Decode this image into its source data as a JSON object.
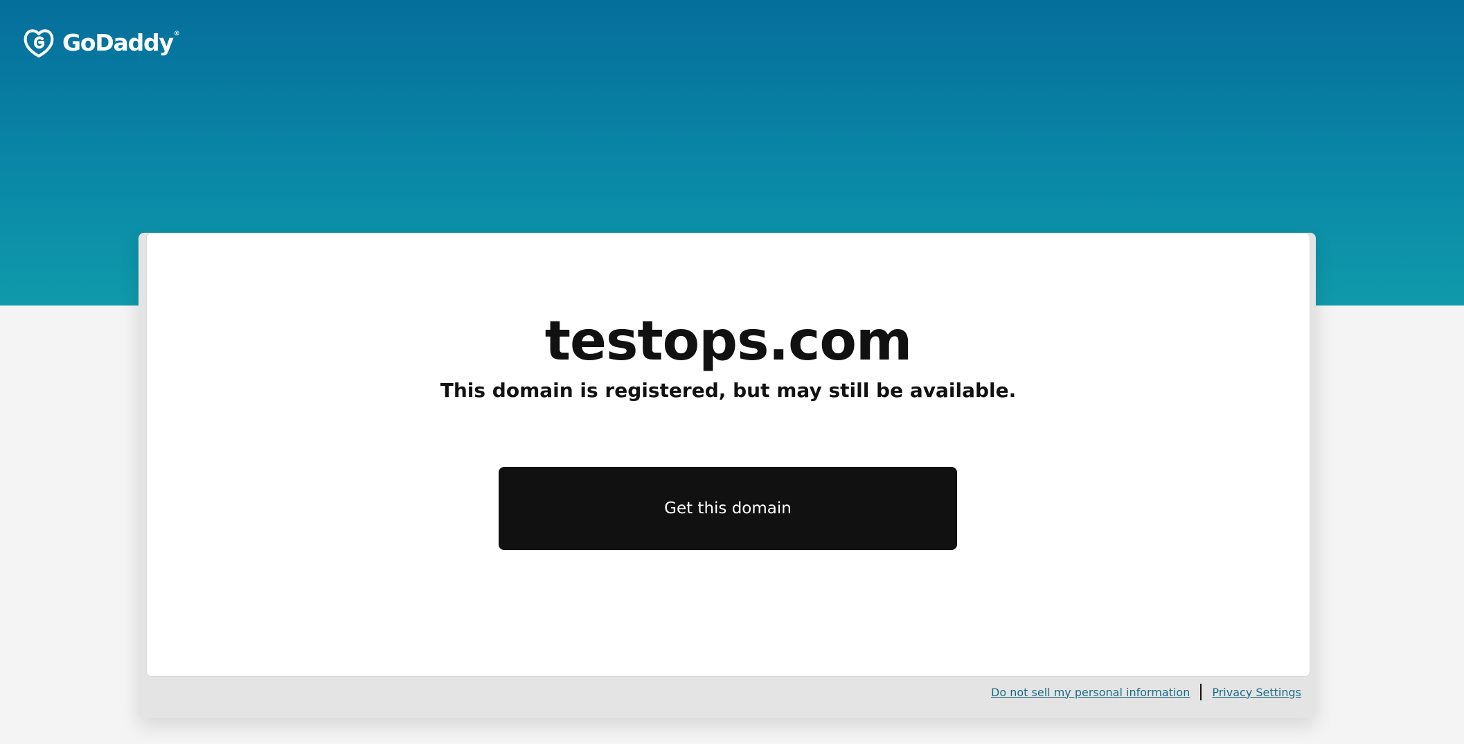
{
  "brand": {
    "logo_text": "GoDaddy",
    "logo_mark": "®",
    "logo_icon": "godaddy-heart-g-icon"
  },
  "colors": {
    "hero_top": "#056e9b",
    "hero_bottom": "#0f9aab",
    "button_bg": "#111111",
    "link": "#1b6d85"
  },
  "main": {
    "domain": "testops.com",
    "message": "This domain is registered, but may still be available.",
    "cta_label": "Get this domain"
  },
  "footer": {
    "links": [
      "Do not sell my personal information",
      "Privacy Settings"
    ]
  }
}
